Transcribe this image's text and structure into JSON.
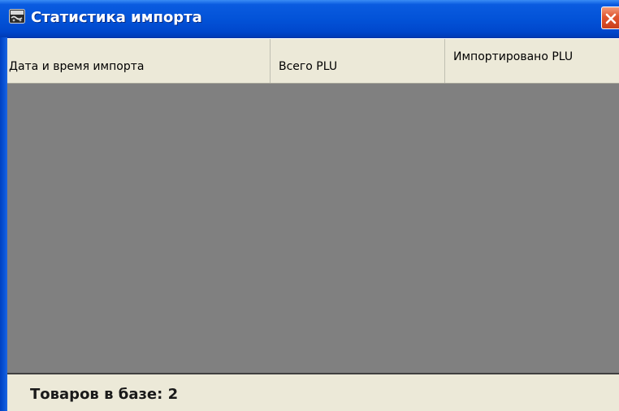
{
  "window": {
    "title": "Статистика импорта",
    "icon": "app-icon",
    "close_icon": "close-icon",
    "colors": {
      "titlebar": "#0353d8",
      "close_button": "#e0552f",
      "grid_background": "#808080",
      "panel_background": "#ece9d8"
    }
  },
  "table": {
    "columns": [
      {
        "label": "Дата и время импорта"
      },
      {
        "label": "Всего PLU"
      },
      {
        "label": "Импортировано PLU"
      }
    ],
    "rows": []
  },
  "status": {
    "text": "Товаров в базе:  2"
  }
}
